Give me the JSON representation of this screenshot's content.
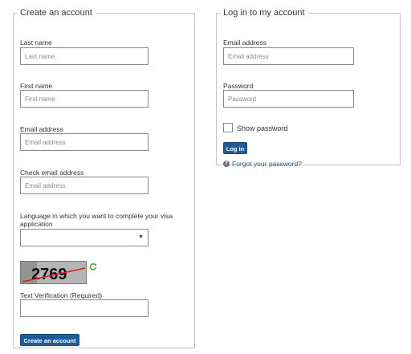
{
  "create": {
    "legend": "Create an account",
    "last_name_label": "Last name",
    "last_name_placeholder": "Last name",
    "first_name_label": "First name",
    "first_name_placeholder": "First name",
    "email_label": "Email address",
    "email_placeholder": "Email address",
    "check_email_label": "Check email address",
    "check_email_placeholder": "Email address",
    "language_label": "Language in which you want to complete your visa application",
    "language_value": "",
    "captcha_text": "2769",
    "text_verification_label": "Text Verification (Required)",
    "submit_label": "Create an account"
  },
  "login": {
    "legend": "Log in to my account",
    "email_label": "Email address",
    "email_placeholder": "Email address",
    "password_label": "Password",
    "password_placeholder": "Password",
    "show_password_label": "Show password",
    "login_label": "Log in",
    "forgot_label": "Forgot your password?"
  },
  "colors": {
    "accent": "#1e5c96",
    "border": "#c4c4c4",
    "captcha_line": "#e01b24",
    "refresh": "#5aa832"
  },
  "icons": [
    "dropdown-arrow-icon",
    "refresh-icon",
    "info-icon"
  ]
}
